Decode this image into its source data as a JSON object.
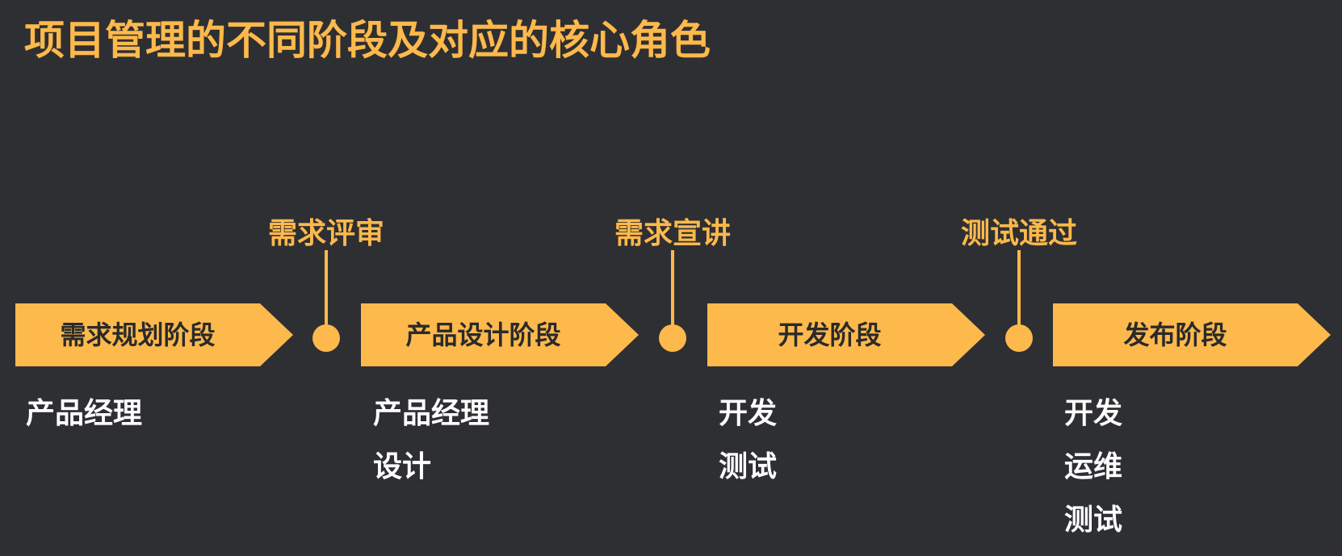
{
  "title": "项目管理的不同阶段及对应的核心角色",
  "colors": {
    "background": "#2e2f33",
    "accent": "#fdb94b",
    "phase_text": "#2a2a2a",
    "role_text": "#ffffff"
  },
  "phases": [
    {
      "label": "需求规划阶段",
      "roles": [
        "产品经理"
      ]
    },
    {
      "label": "产品设计阶段",
      "roles": [
        "产品经理",
        "设计"
      ]
    },
    {
      "label": "开发阶段",
      "roles": [
        "开发",
        "测试"
      ]
    },
    {
      "label": "发布阶段",
      "roles": [
        "开发",
        "运维",
        "测试"
      ]
    }
  ],
  "milestones": [
    {
      "label": "需求评审"
    },
    {
      "label": "需求宣讲"
    },
    {
      "label": "测试通过"
    }
  ]
}
